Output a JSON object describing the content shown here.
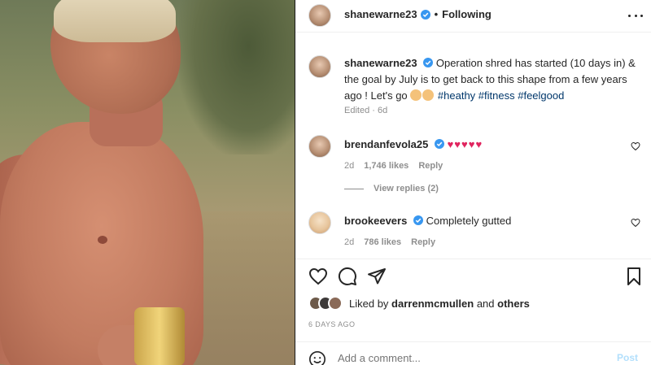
{
  "post": {
    "author": "shanewarne23",
    "following_label": "Following",
    "caption_author": "shanewarne23",
    "caption_text": "Operation shred has started (10 days in) & the goal by July is to get back to this shape from a few years ago ! Let's go",
    "hashtags": [
      "#heathy",
      "#fitness",
      "#feelgood"
    ],
    "caption_meta": "Edited · 6d"
  },
  "comments": [
    {
      "username": "brendanfevola25",
      "text": "♥♥♥♥♥",
      "age": "2d",
      "likes": "1,746 likes",
      "reply_label": "Reply",
      "view_replies": "View replies (2)"
    },
    {
      "username": "brookeevers",
      "text": "Completely gutted",
      "age": "2d",
      "likes": "786 likes",
      "reply_label": "Reply"
    }
  ],
  "likes": {
    "prefix": "Liked by",
    "user": "darrenmcmullen",
    "and": "and",
    "others": "others"
  },
  "timestamp": "6 DAYS AGO",
  "add_comment": {
    "placeholder": "Add a comment...",
    "post_label": "Post"
  },
  "icons": {
    "verified": "verified-badge-icon",
    "more": "more-options-icon",
    "heart": "heart-icon",
    "comment": "comment-icon",
    "share": "share-icon",
    "save": "bookmark-icon",
    "emoji": "emoji-icon"
  },
  "colors": {
    "verified": "#3897f0",
    "hashtag": "#00376b",
    "heart_emoji": "#e0245e",
    "post_button": "#b2dffc"
  }
}
